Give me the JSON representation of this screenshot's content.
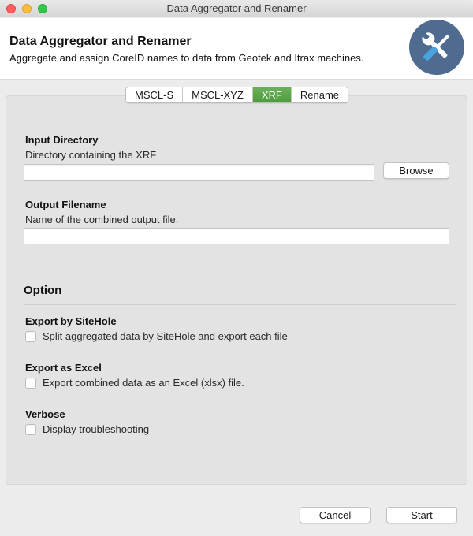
{
  "window": {
    "title": "Data Aggregator and Renamer"
  },
  "header": {
    "title": "Data Aggregator and Renamer",
    "subtitle": "Aggregate and assign CoreID names to data from Geotek and Itrax machines.",
    "icon": "tools-icon",
    "icon_bg_color": "#4f6b8f"
  },
  "tabs": [
    {
      "label": "MSCL-S",
      "active": false
    },
    {
      "label": "MSCL-XYZ",
      "active": false
    },
    {
      "label": "XRF",
      "active": true
    },
    {
      "label": "Rename",
      "active": false
    }
  ],
  "accent_color": "#4e9a3e",
  "input_directory": {
    "title": "Input Directory",
    "description": "Directory containing the XRF",
    "value": "",
    "browse_label": "Browse"
  },
  "output_filename": {
    "title": "Output Filename",
    "description": "Name of the combined output file.",
    "value": ""
  },
  "options": {
    "section_title": "Option",
    "items": [
      {
        "title": "Export by SiteHole",
        "label": "Split aggregated data by SiteHole and export each file",
        "checked": false
      },
      {
        "title": "Export as Excel",
        "label": "Export combined data as an Excel (xlsx) file.",
        "checked": false
      },
      {
        "title": "Verbose",
        "label": "Display troubleshooting",
        "checked": false
      }
    ]
  },
  "footer": {
    "cancel_label": "Cancel",
    "start_label": "Start"
  }
}
